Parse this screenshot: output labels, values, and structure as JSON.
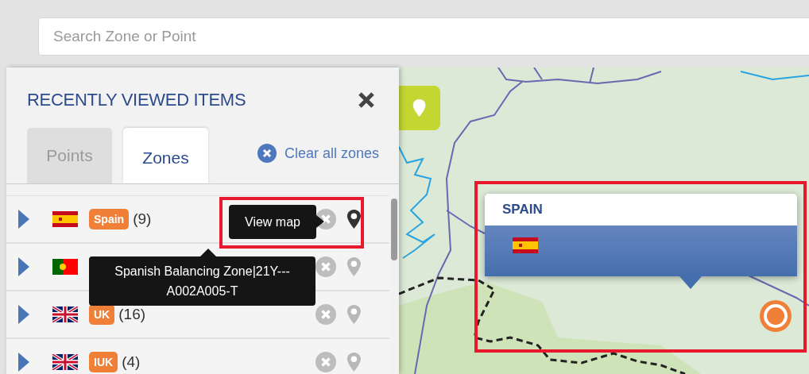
{
  "search": {
    "placeholder": "Search Zone or Point"
  },
  "panel": {
    "title": "RECENTLY VIEWED ITEMS",
    "tabs": [
      {
        "label": "Points",
        "selected": false
      },
      {
        "label": "Zones",
        "selected": true
      }
    ],
    "clear_link": "Clear all zones",
    "rows": [
      {
        "kind": "es",
        "label": "Spain",
        "count": "(9)",
        "map_hovered": true
      },
      {
        "kind": "pt",
        "map_hovered": false
      },
      {
        "kind": "gb",
        "label": "UK",
        "count": "(16)",
        "map_hovered": false
      },
      {
        "kind": "gb",
        "label": "IUK",
        "count": "(4)",
        "map_hovered": false
      }
    ],
    "map_tooltip": "View map",
    "zone_tooltip": {
      "lines": [
        "Spanish Balancing Zone|21Y---",
        "A002A005-T"
      ]
    }
  },
  "map": {
    "popup": {
      "title": "SPAIN",
      "kind": "es"
    }
  }
}
